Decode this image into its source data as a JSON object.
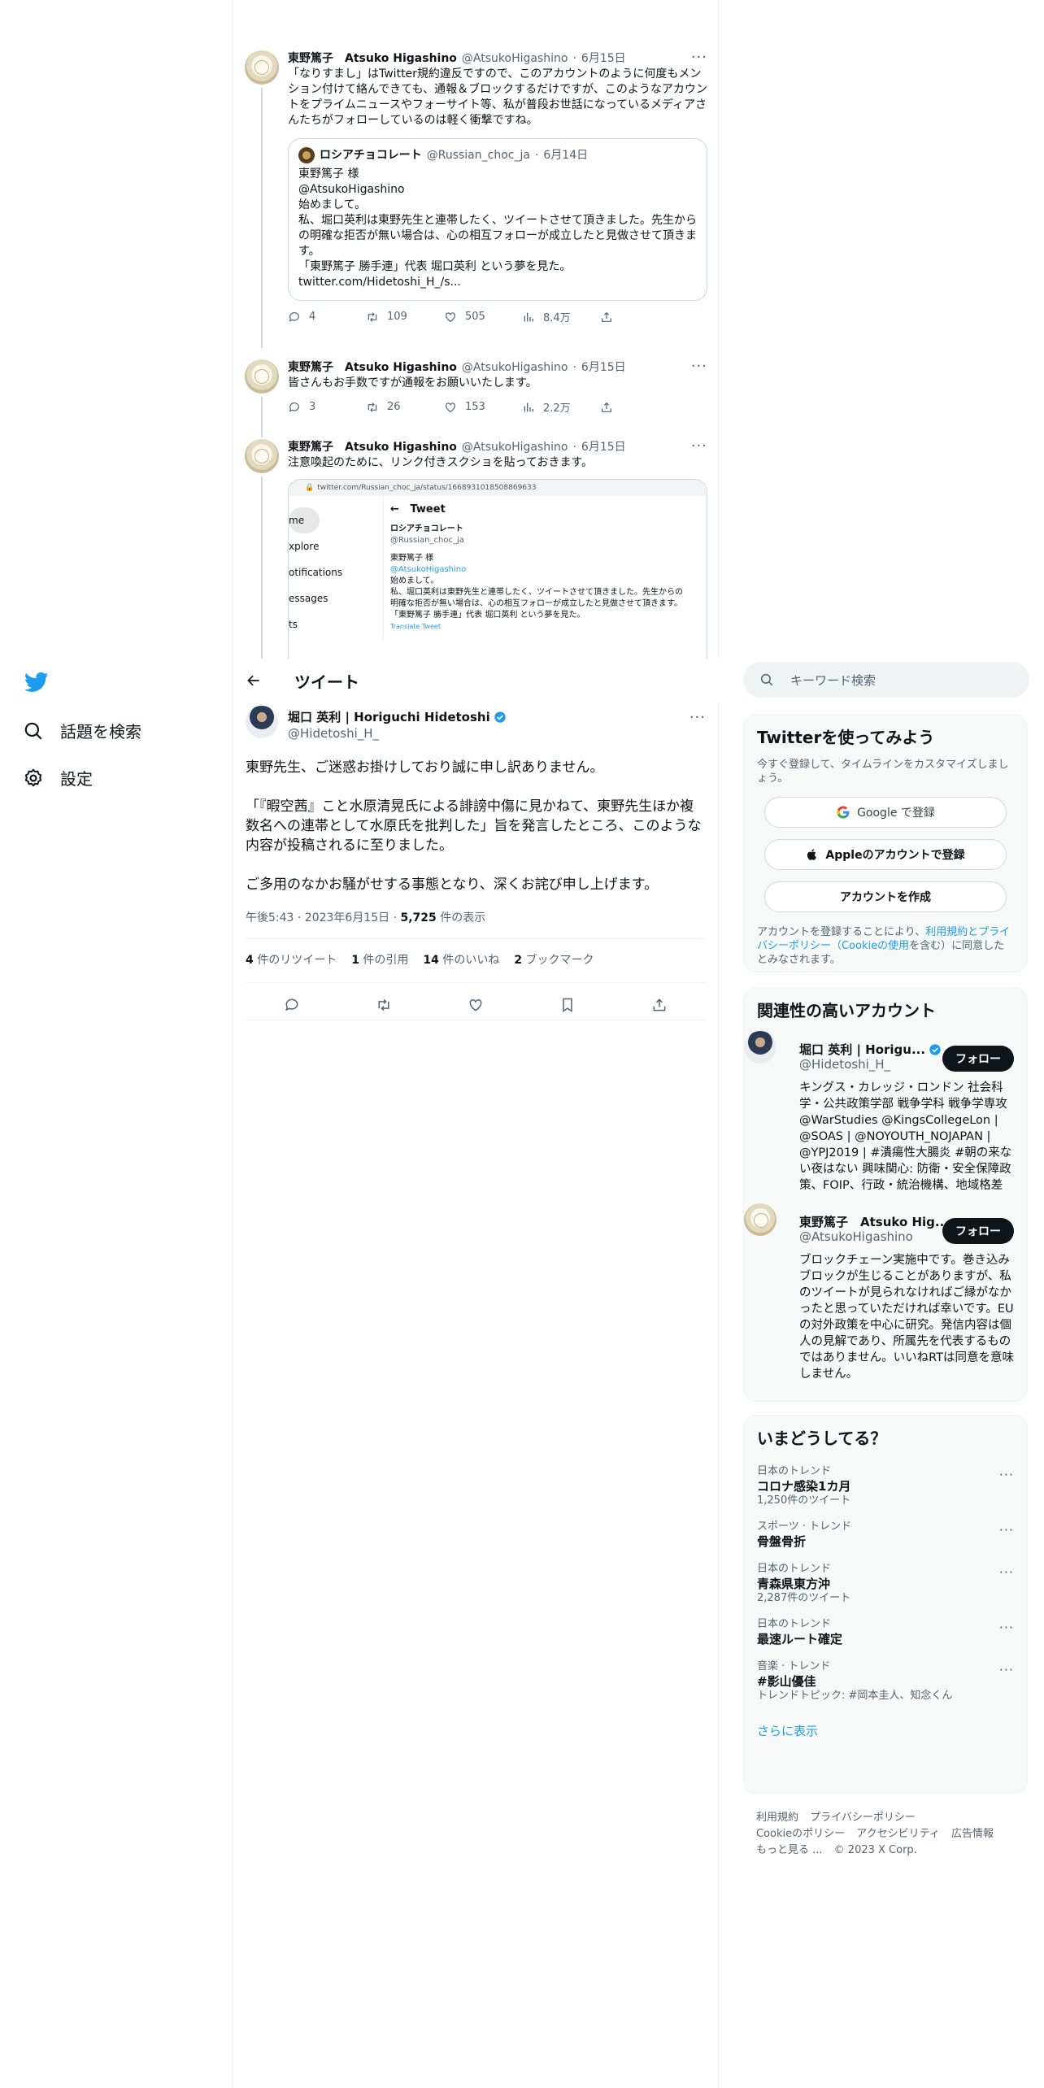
{
  "nav": {
    "search_label": "話題を検索",
    "settings_label": "設定"
  },
  "thread": {
    "tweet1": {
      "name": "東野篤子　Atsuko Higashino",
      "handle": "@AtsukoHigashino",
      "date": "6月15日",
      "text": "「なりすまし」はTwitter規約違反ですので、このアカウントのように何度もメンション付けて絡んできても、通報＆ブロックするだけですが、このようなアカウントをプライムニュースやフォーサイト等、私が普段お世話になっているメディアさんたちがフォローしているのは軽く衝撃ですね。",
      "quote": {
        "name": "ロシアチョコレート",
        "handle": "@Russian_choc_ja",
        "date": "6月14日",
        "line1": "東野篤子 様",
        "line2": "@AtsukoHigashino",
        "line3": "始めまして。",
        "line4": "私、堀口英利は東野先生と連帯したく、ツイートさせて頂きました。先生からの明確な拒否が無い場合は、心の相互フォローが成立したと見做させて頂きます。",
        "line5": "「東野篤子 勝手連」代表 堀口英利 という夢を見た。",
        "line6": "twitter.com/Hidetoshi_H_/s..."
      },
      "replies": "4",
      "retweets": "109",
      "likes": "505",
      "views": "8.4万"
    },
    "tweet2": {
      "name": "東野篤子　Atsuko Higashino",
      "handle": "@AtsukoHigashino",
      "date": "6月15日",
      "text": "皆さんもお手数ですが通報をお願いいたします。",
      "replies": "3",
      "retweets": "26",
      "likes": "153",
      "views": "2.2万"
    },
    "tweet3": {
      "name": "東野篤子　Atsuko Higashino",
      "handle": "@AtsukoHigashino",
      "date": "6月15日",
      "text": "注意喚起のために、リンク付きスクショを貼っておきます。",
      "screenshot": {
        "url": "twitter.com/Russian_choc_ja/status/1668931018508869633",
        "nav": [
          "me",
          "xplore",
          "otifications",
          "essages",
          "ts"
        ],
        "title": "Tweet",
        "name": "ロシアチョコレート",
        "handle": "@Russian_choc_ja",
        "l1": "東野篤子 様",
        "l2": "@AtsukoHigashino",
        "l3": "始めまして。",
        "l4": "私、堀口英利は東野先生と連帯したく、ツイートさせて頂きました。先生からの明確な拒否が無い場合は、心の相互フォローが成立したと見做させて頂きます。",
        "l5": "「東野篤子 勝手連」代表 堀口英利 という夢を見た。",
        "translate": "Translate Tweet"
      }
    }
  },
  "header": {
    "title": "ツイート"
  },
  "focal": {
    "name": "堀口 英利 | Horiguchi Hidetoshi",
    "handle": "@Hidetoshi_H_",
    "text": "東野先生、ご迷惑お掛けしており誠に申し訳ありません。\n\n「『暇空茜』こと水原清晃氏による誹謗中傷に見かねて、東野先生ほか複数名への連帯として水原氏を批判した」旨を発言したところ、このような内容が投稿されるに至りました。\n\nご多用のなかお騒がせする事態となり、深くお詫び申し上げます。",
    "time": "午後5:43 · 2023年6月15日 · ",
    "views_count": "5,725",
    "views_label": " 件の表示",
    "retweets_count": "4",
    "retweets_label": " 件のリツイート",
    "quotes_count": "1",
    "quotes_label": " 件の引用",
    "likes_count": "14",
    "likes_label": " 件のいいね",
    "bookmarks_count": "2",
    "bookmarks_label": " ブックマーク"
  },
  "sidebar": {
    "search_placeholder": "キーワード検索",
    "signup": {
      "title": "Twitterを使ってみよう",
      "desc": "今すぐ登録して、タイムラインをカスタマイズしましょう。",
      "google": "Google で登録",
      "apple": "Appleのアカウントで登録",
      "create": "アカウントを作成",
      "legal_pre": "アカウントを登録することにより、",
      "legal_link": "利用規約とプライバシーポリシー（Cookieの使用",
      "legal_post": "を含む）に同意したとみなされます。"
    },
    "related": {
      "title": "関連性の高いアカウント",
      "follow_label": "フォロー",
      "accounts": [
        {
          "name": "堀口 英利 | Horigu...",
          "handle": "@Hidetoshi_H_",
          "bio": "キングス・カレッジ・ロンドン 社会科学・公共政策学部 戦争学科 戦争学専攻 @WarStudies @KingsCollegeLon | @SOAS | @NOYOUTH_NOJAPAN | @YPJ2019 | #潰瘍性大腸炎 #朝の来ない夜はない 興味関心: 防衛・安全保障政策、FOIP、行政・統治機構、地域格差"
        },
        {
          "name": "東野篤子　Atsuko Hig...",
          "handle": "@AtsukoHigashino",
          "bio": "ブロックチェーン実施中です。巻き込みブロックが生じることがありますが、私のツイートが見られなければご縁がなかったと思っていただければ幸いです。EUの対外政策を中心に研究。発信内容は個人の見解であり、所属先を代表するものではありません。いいねRTは同意を意味しません。"
        }
      ]
    },
    "trends": {
      "title": "いまどうしてる？",
      "items": [
        {
          "meta": "日本のトレンド",
          "name": "コロナ感染1カ月",
          "count": "1,250件のツイート"
        },
        {
          "meta": "スポーツ · トレンド",
          "name": "骨盤骨折",
          "count": ""
        },
        {
          "meta": "日本のトレンド",
          "name": "青森県東方沖",
          "count": "2,287件のツイート"
        },
        {
          "meta": "日本のトレンド",
          "name": "最速ルート確定",
          "count": ""
        },
        {
          "meta": "音楽 · トレンド",
          "name": "#影山優佳",
          "count": "トレンドトピック: #岡本圭人、知念くん"
        }
      ],
      "show_more": "さらに表示"
    },
    "footer": {
      "terms": "利用規約",
      "privacy": "プライバシーポリシー",
      "cookie": "Cookieのポリシー",
      "access": "アクセシビリティ",
      "ads": "広告情報",
      "more": "もっと見る ...",
      "copyright": "© 2023 X Corp."
    }
  },
  "colors": {
    "accent": "#1d9bf0",
    "text": "#0f1419",
    "muted": "#536471",
    "border": "#eff3f4"
  }
}
